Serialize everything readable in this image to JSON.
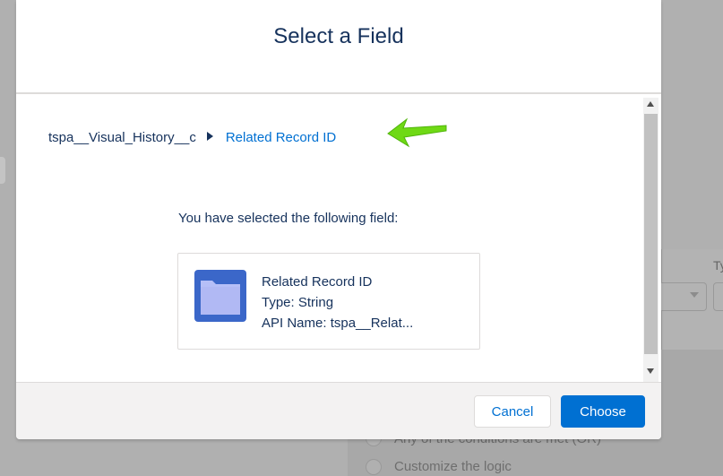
{
  "modal": {
    "title": "Select a Field",
    "breadcrumb": {
      "root": "tspa__Visual_History__c",
      "current": "Related Record ID"
    },
    "selected_label": "You have selected the following field:",
    "field": {
      "name": "Related Record ID",
      "type_line": "Type: String",
      "api_line": "API Name: tspa__Relat..."
    },
    "buttons": {
      "cancel": "Cancel",
      "choose": "Choose"
    }
  },
  "background": {
    "column_label": "Ty",
    "radio_or": "Any of the conditions are met (OR)",
    "radio_custom": "Customize the logic"
  },
  "colors": {
    "brand": "#0070d2",
    "title_text": "#16325c",
    "annotation_arrow": "#6fd915",
    "folder_icon": "#3b67c9"
  },
  "icons": {
    "field": "folder-icon",
    "breadcrumb_separator": "caret-right-icon",
    "annotation": "arrow-left-icon"
  }
}
